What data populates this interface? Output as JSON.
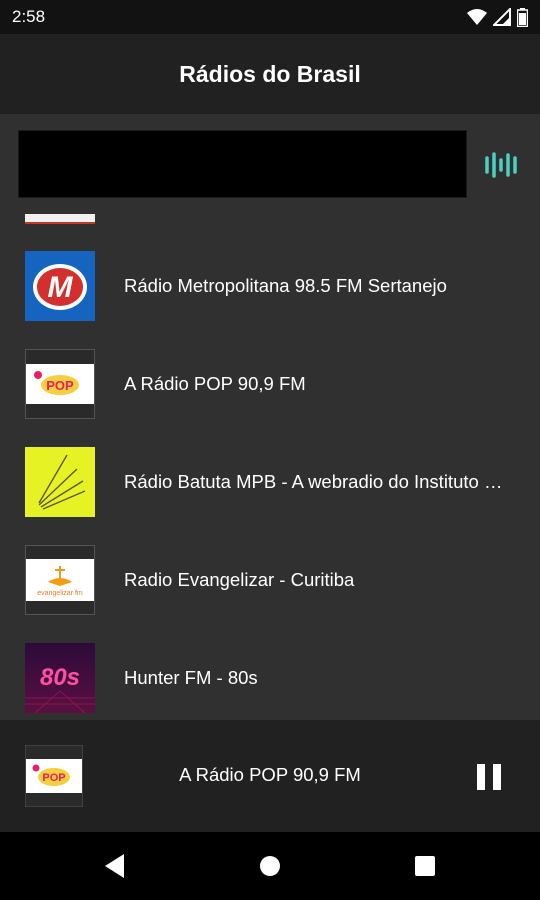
{
  "status": {
    "time": "2:58",
    "icons": [
      "wifi-icon",
      "signal-icon",
      "battery-icon"
    ]
  },
  "app_bar": {
    "title": "Rádios do Brasil"
  },
  "search": {
    "value": "",
    "visualizer_icon": "audio-wave-icon",
    "accent_color": "#4dd0c0"
  },
  "stations": [
    {
      "title": "Rádio Metropolitana 98.5 FM Sertanejo",
      "logo": "metropolitana-logo"
    },
    {
      "title": "A Rádio POP 90,9 FM",
      "logo": "radio-pop-logo"
    },
    {
      "title": "Rádio Batuta MPB - A webradio do Instituto Moreira Salles",
      "logo": "batuta-logo"
    },
    {
      "title": "Radio Evangelizar - Curitiba",
      "logo": "evangelizar-logo"
    },
    {
      "title": "Hunter FM - 80s",
      "logo": "hunter-80s-logo"
    }
  ],
  "logo_text": {
    "metropolitana": "M",
    "pop": "POP",
    "evangelizar": "evangelizar fm",
    "hunter": "80s"
  },
  "now_playing": {
    "title": "A Rádio POP 90,9 FM",
    "state": "playing",
    "control_icon": "pause-icon"
  },
  "nav": {
    "icons": [
      "back-icon",
      "home-icon",
      "recents-icon"
    ]
  }
}
